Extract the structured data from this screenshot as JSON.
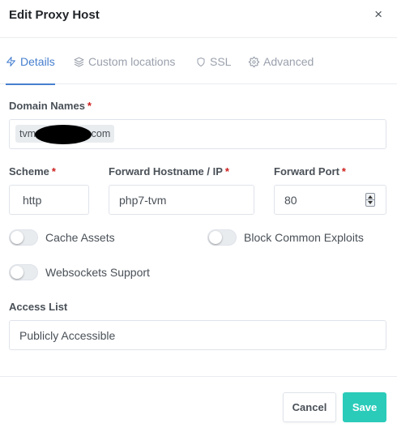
{
  "modal": {
    "title": "Edit Proxy Host",
    "close_label": "×"
  },
  "tabs": [
    {
      "label": "Details",
      "icon": "bolt-icon",
      "active": true
    },
    {
      "label": "Custom locations",
      "icon": "layers-icon",
      "active": false
    },
    {
      "label": "SSL",
      "icon": "shield-icon",
      "active": false
    },
    {
      "label": "Advanced",
      "icon": "gear-icon",
      "active": false
    }
  ],
  "form": {
    "domain_names": {
      "label": "Domain Names",
      "required_mark": "*",
      "chip_prefix": "tvm",
      "chip_suffix": ".com"
    },
    "scheme": {
      "label": "Scheme",
      "required_mark": "*",
      "value": "http"
    },
    "forward_host": {
      "label": "Forward Hostname / IP",
      "required_mark": "*",
      "value": "php7-tvm"
    },
    "forward_port": {
      "label": "Forward Port",
      "required_mark": "*",
      "value": "80"
    },
    "toggles": {
      "cache_assets": {
        "label": "Cache Assets",
        "checked": false
      },
      "block_exploits": {
        "label": "Block Common Exploits",
        "checked": false
      },
      "websockets": {
        "label": "Websockets Support",
        "checked": false
      }
    },
    "access_list": {
      "label": "Access List",
      "value": "Publicly Accessible"
    }
  },
  "footer": {
    "cancel_label": "Cancel",
    "save_label": "Save"
  },
  "colors": {
    "accent": "#467fcf",
    "save": "#2bcbba",
    "required": "#cd201f"
  }
}
